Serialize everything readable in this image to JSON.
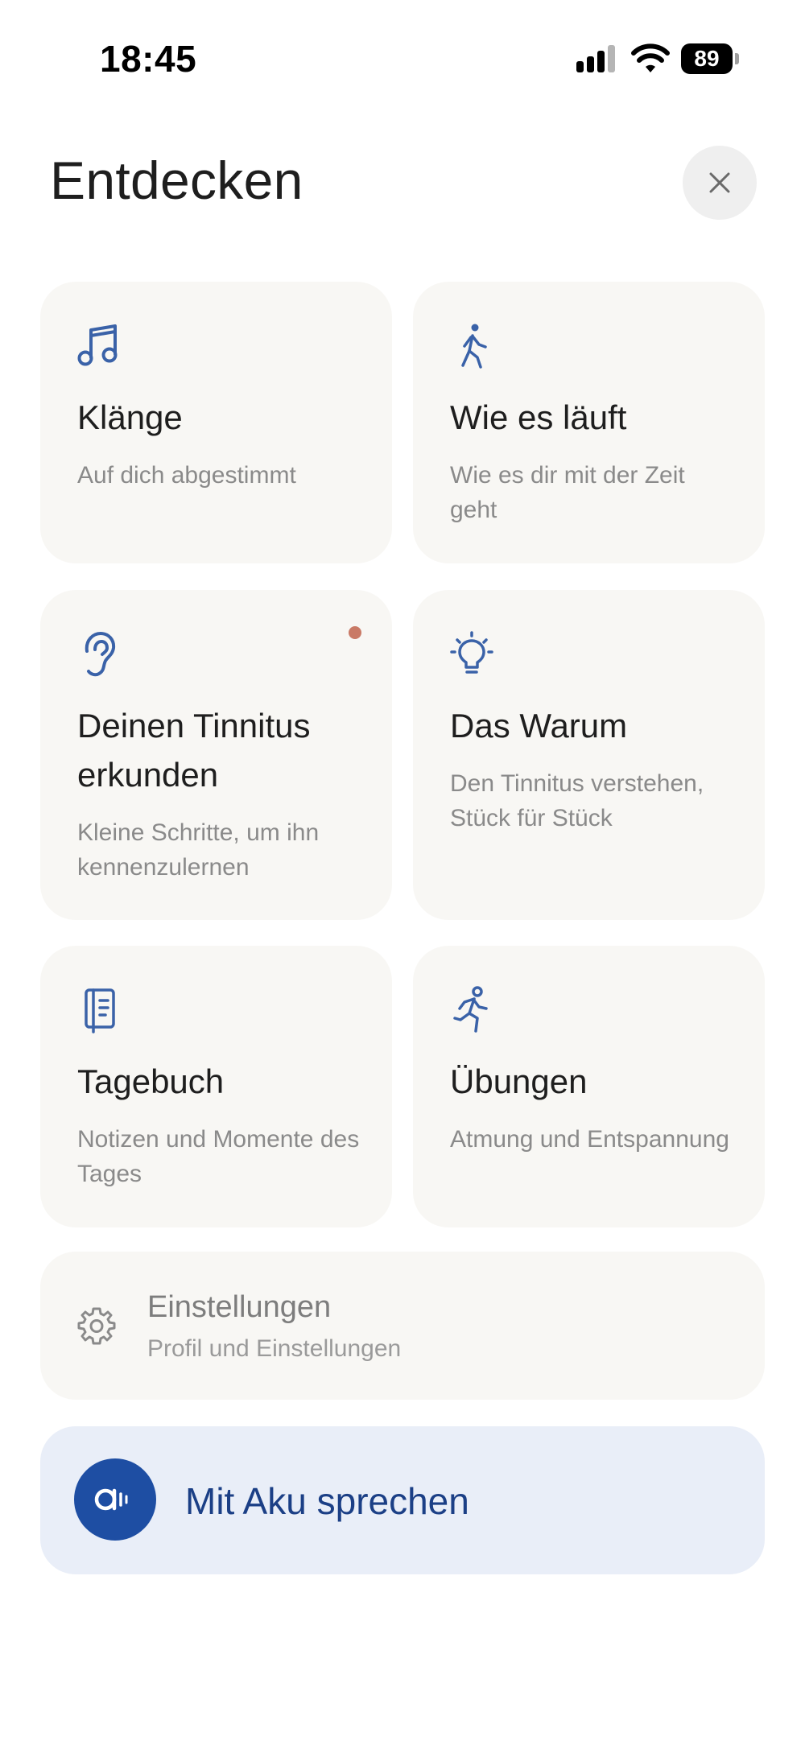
{
  "status_bar": {
    "time": "18:45",
    "battery": "89"
  },
  "header": {
    "title": "Entdecken",
    "close_icon": "close-icon"
  },
  "cards": [
    {
      "icon": "music-note-icon",
      "title": "Klänge",
      "subtitle": "Auf dich abgestimmt"
    },
    {
      "icon": "walking-person-icon",
      "title": "Wie es läuft",
      "subtitle": "Wie es dir mit der Zeit geht"
    },
    {
      "icon": "ear-icon",
      "title": "Deinen Tinnitus erkunden",
      "subtitle": "Kleine Schritte, um ihn kennenzulernen",
      "has_notification": true
    },
    {
      "icon": "lightbulb-icon",
      "title": "Das Warum",
      "subtitle": "Den Tinnitus verstehen, Stück für Stück"
    },
    {
      "icon": "journal-icon",
      "title": "Tagebuch",
      "subtitle": "Notizen und Momente des Tages"
    },
    {
      "icon": "running-person-icon",
      "title": "Übungen",
      "subtitle": "Atmung und Entspannung"
    }
  ],
  "settings": {
    "icon": "gear-icon",
    "title": "Einstellungen",
    "subtitle": "Profil und Einstellungen"
  },
  "assistant": {
    "icon": "aku-voice-icon",
    "label": "Mit Aku sprechen"
  },
  "colors": {
    "accent_blue": "#1e4ea3",
    "icon_blue": "#3a62a8",
    "card_bg": "#f8f7f4",
    "assistant_bg": "#e9eef8",
    "notification_dot": "#c97a66"
  }
}
